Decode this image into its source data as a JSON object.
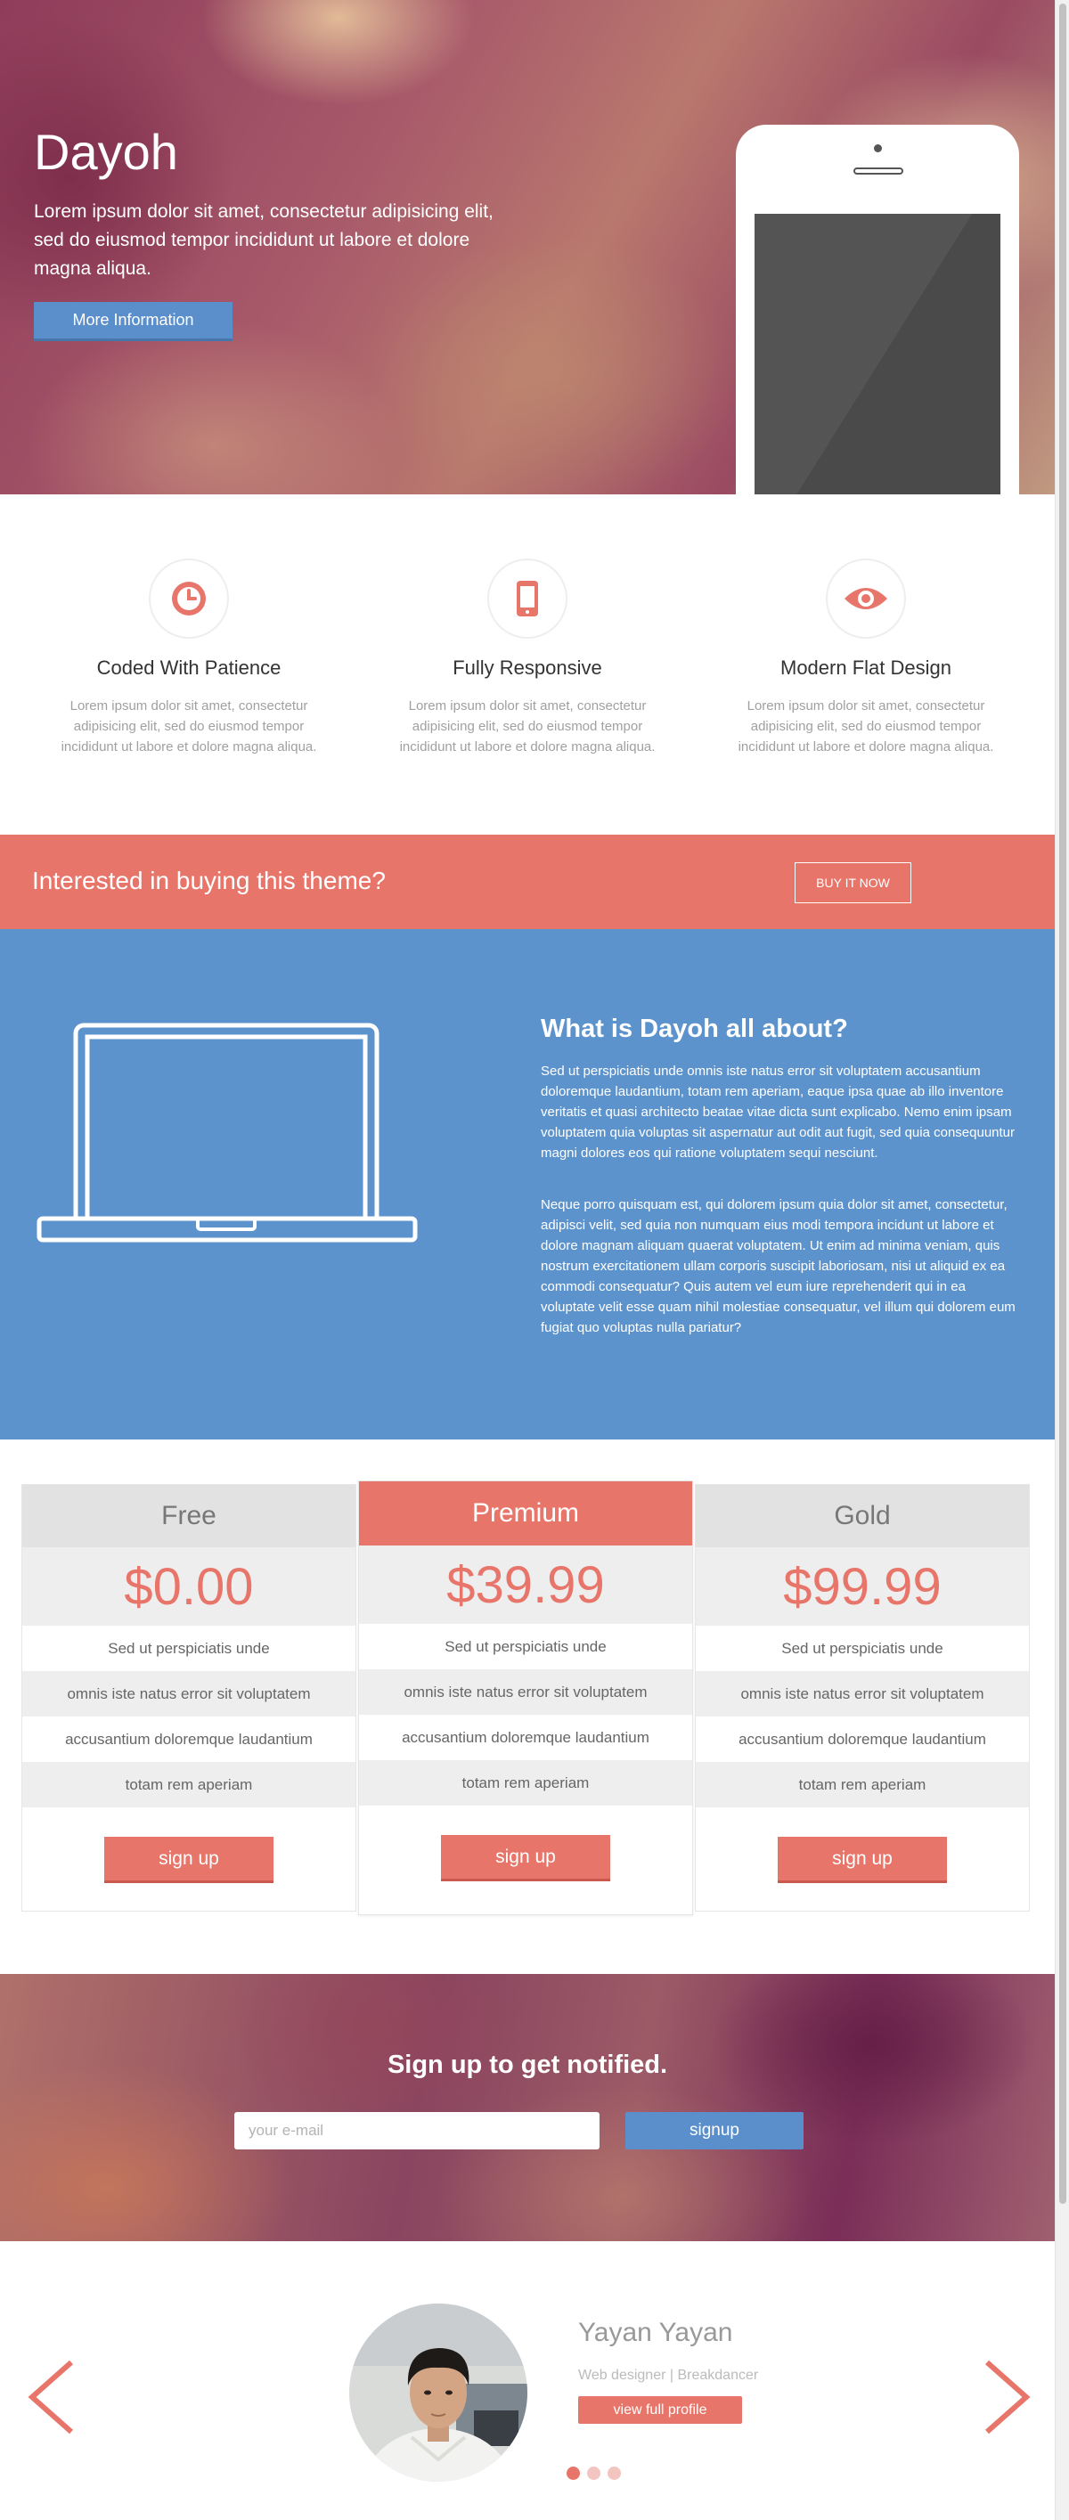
{
  "hero": {
    "title": "Dayoh",
    "text": "Lorem ipsum dolor sit amet, consectetur adipisicing elit, sed do eiusmod tempor incididunt ut labore et dolore magna aliqua.",
    "button_label": "More Information"
  },
  "features": [
    {
      "icon": "clock-icon",
      "title": "Coded With Patience",
      "text": "Lorem ipsum dolor sit amet, consectetur adipisicing elit, sed do eiusmod tempor incididunt ut labore et dolore magna aliqua."
    },
    {
      "icon": "mobile-phone-icon",
      "title": "Fully Responsive",
      "text": "Lorem ipsum dolor sit amet, consectetur adipisicing elit, sed do eiusmod tempor incididunt ut labore et dolore magna aliqua."
    },
    {
      "icon": "eye-icon",
      "title": "Modern Flat Design",
      "text": "Lorem ipsum dolor sit amet, consectetur adipisicing elit, sed do eiusmod tempor incididunt ut labore et dolore magna aliqua."
    }
  ],
  "cta": {
    "text": "Interested in buying this theme?",
    "button_label": "BUY IT NOW"
  },
  "about": {
    "title": "What is Dayoh all about?",
    "paragraphs": [
      "Sed ut perspiciatis unde omnis iste natus error sit voluptatem accusantium doloremque laudantium, totam rem aperiam, eaque ipsa quae ab illo inventore veritatis et quasi architecto beatae vitae dicta sunt explicabo. Nemo enim ipsam voluptatem quia voluptas sit aspernatur aut odit aut fugit, sed quia consequuntur magni dolores eos qui ratione voluptatem sequi nesciunt.",
      "Neque porro quisquam est, qui dolorem ipsum quia dolor sit amet, consectetur, adipisci velit, sed quia non numquam eius modi tempora incidunt ut labore et dolore magnam aliquam quaerat voluptatem. Ut enim ad minima veniam, quis nostrum exercitationem ullam corporis suscipit laboriosam, nisi ut aliquid ex ea commodi consequatur? Quis autem vel eum iure reprehenderit qui in ea voluptate velit esse quam nihil molestiae consequatur, vel illum qui dolorem eum fugiat quo voluptas nulla pariatur?"
    ]
  },
  "pricing": {
    "plans": [
      {
        "name": "Free",
        "price": "$0.00",
        "features": [
          "Sed ut perspiciatis unde",
          "omnis iste natus error sit voluptatem",
          "accusantium doloremque laudantium",
          "totam rem aperiam"
        ],
        "button_label": "sign up"
      },
      {
        "name": "Premium",
        "price": "$39.99",
        "features": [
          "Sed ut perspiciatis unde",
          "omnis iste natus error sit voluptatem",
          "accusantium doloremque laudantium",
          "totam rem aperiam"
        ],
        "button_label": "sign up"
      },
      {
        "name": "Gold",
        "price": "$99.99",
        "features": [
          "Sed ut perspiciatis unde",
          "omnis iste natus error sit voluptatem",
          "accusantium doloremque laudantium",
          "totam rem aperiam"
        ],
        "button_label": "sign up"
      }
    ]
  },
  "newsletter": {
    "title": "Sign up to get notified.",
    "email_placeholder": "your e-mail",
    "button_label": "signup"
  },
  "testimonial": {
    "name": "Yayan Yayan",
    "role": "Web designer | Breakdancer",
    "button_label": "view full profile",
    "slide_count": 3,
    "active_slide": 1
  },
  "colors": {
    "accent_coral": "#e8756a",
    "accent_blue": "#5b8fcb",
    "about_background": "#5d93cd"
  }
}
